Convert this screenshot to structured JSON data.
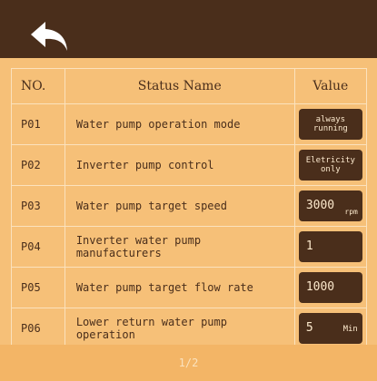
{
  "header": {
    "back_icon": "back-arrow-icon"
  },
  "table": {
    "columns": {
      "no": "NO.",
      "name": "Status Name",
      "value": "Value"
    },
    "rows": [
      {
        "no": "P01",
        "name": "Water pump operation mode",
        "value": "always running",
        "unit": ""
      },
      {
        "no": "P02",
        "name": "Inverter pump control",
        "value": "Eletricity only",
        "unit": ""
      },
      {
        "no": "P03",
        "name": "Water pump target speed",
        "value": "3000",
        "unit": "rpm"
      },
      {
        "no": "P04",
        "name": "Inverter water pump manufacturers",
        "value": "1",
        "unit": ""
      },
      {
        "no": "P05",
        "name": "Water pump target flow rate",
        "value": "1000",
        "unit": ""
      },
      {
        "no": "P06",
        "name": "Lower return water pump operation",
        "value": "5",
        "unit": "Min"
      }
    ]
  },
  "footer": {
    "page_indicator": "1/2"
  },
  "colors": {
    "header_bg": "#4a2e1b",
    "page_bg": "#f6c078",
    "value_box_bg": "#4a2e1b"
  }
}
